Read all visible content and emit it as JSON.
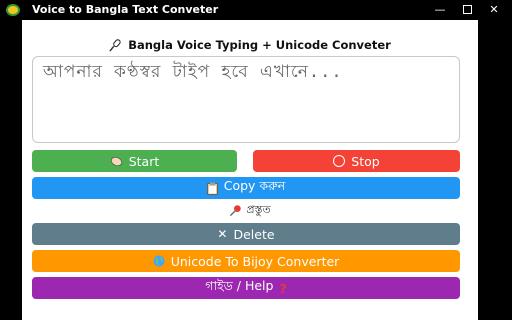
{
  "window": {
    "title": "Voice to Bangla Text Conveter",
    "min_label": "—",
    "close_label": "✕"
  },
  "header": {
    "title": "Bangla Voice Typing + Unicode Conveter"
  },
  "editor": {
    "placeholder": "আপনার কণ্ঠস্বর টাইপ হবে এখানে..."
  },
  "buttons": {
    "start": "Start",
    "stop": "Stop",
    "copy": "Copy করুন",
    "delete": "Delete",
    "unicode": "Unicode To Bijoy Converter",
    "help": "গাইড / Help"
  },
  "status": {
    "text": "প্রস্তুত"
  }
}
